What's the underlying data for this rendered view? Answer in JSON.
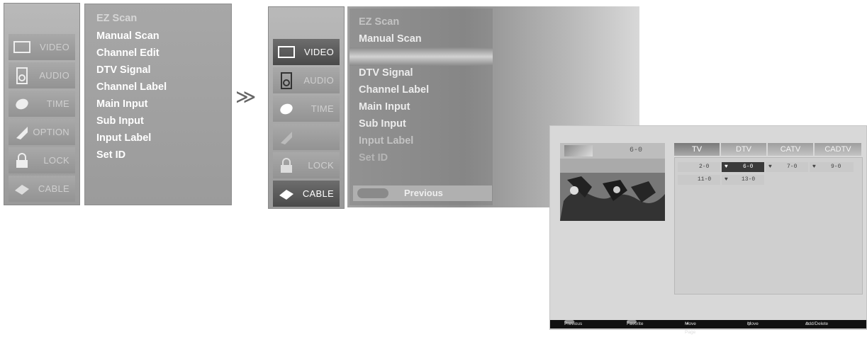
{
  "left_menu": {
    "side_items": [
      {
        "label": "VIDEO",
        "icon": "monitor-icon"
      },
      {
        "label": "AUDIO",
        "icon": "speaker-icon"
      },
      {
        "label": "TIME",
        "icon": "clock-icon"
      },
      {
        "label": "OPTION",
        "icon": "tag-icon"
      },
      {
        "label": "LOCK",
        "icon": "lock-icon"
      },
      {
        "label": "CABLE",
        "icon": "cable-icon"
      }
    ],
    "items": [
      "EZ Scan",
      "Manual Scan",
      "Channel Edit",
      "DTV Signal",
      "Channel Label",
      "Main Input",
      "Sub Input",
      "Input Label",
      "Set ID"
    ]
  },
  "arrow": "≫",
  "right_menu": {
    "side_items": [
      {
        "label": "VIDEO",
        "icon": "monitor-icon"
      },
      {
        "label": "AUDIO",
        "icon": "speaker-icon"
      },
      {
        "label": "TIME",
        "icon": "clock-icon"
      },
      {
        "label": "",
        "icon": "tag-icon"
      },
      {
        "label": "LOCK",
        "icon": "lock-icon"
      },
      {
        "label": "CABLE",
        "icon": "cable-icon"
      }
    ],
    "items": [
      "EZ Scan",
      "Manual Scan",
      "",
      "DTV Signal",
      "Channel Label",
      "Main Input",
      "Sub Input",
      "Input Label",
      "Set ID"
    ],
    "previous_label": "Previous"
  },
  "channel_edit": {
    "current_channel": "6-0",
    "tabs": [
      "TV",
      "DTV",
      "CATV",
      "CADTV"
    ],
    "channels": [
      {
        "num": "2-0",
        "fav": ""
      },
      {
        "num": "6-0",
        "fav": "♥",
        "selected": true
      },
      {
        "num": "7-0",
        "fav": "♥"
      },
      {
        "num": "9-0",
        "fav": "♥"
      },
      {
        "num": "11-0",
        "fav": ""
      },
      {
        "num": "13-0",
        "fav": "♥"
      }
    ],
    "footer": {
      "previous": "Previous",
      "favorite": "Favorite",
      "move_page": "Move Page",
      "move": "Move",
      "add_delete": "Add/Delete"
    }
  }
}
